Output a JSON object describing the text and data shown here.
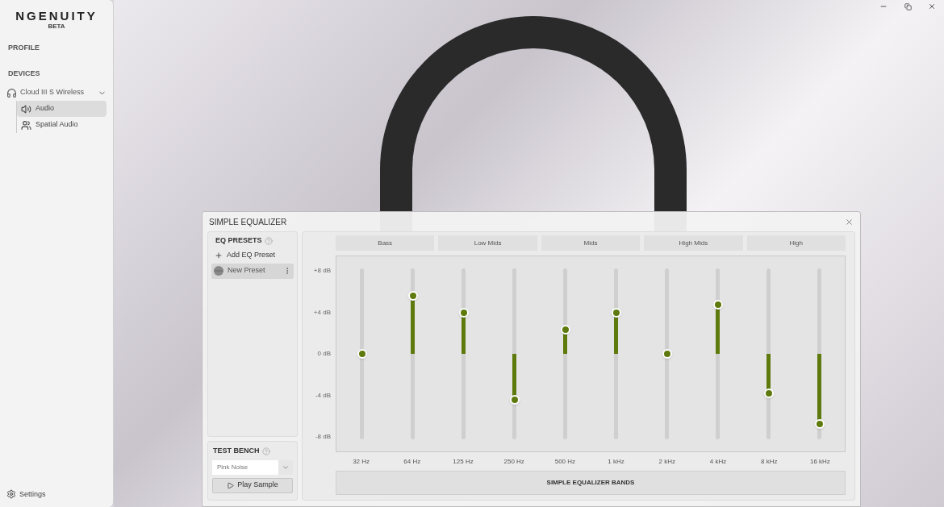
{
  "sidebar": {
    "logo": "NGENUITY",
    "logo_badge": "BETA",
    "sections": [
      {
        "label": "PROFILE"
      },
      {
        "label": "DEVICES"
      }
    ],
    "device": {
      "name": "Cloud III S Wireless",
      "expanded": true,
      "items": [
        {
          "label": "Audio",
          "kind": "speaker",
          "selected": true
        },
        {
          "label": "Spatial Audio",
          "kind": "spatial",
          "selected": false
        }
      ]
    },
    "settings": "Settings"
  },
  "dialog": {
    "title": "SIMPLE EQUALIZER",
    "presets": {
      "title": "EQ PRESETS",
      "add": "Add EQ Preset",
      "items": [
        {
          "label": "New Preset",
          "selected": true
        }
      ]
    },
    "test_bench": {
      "title": "TEST BENCH",
      "source": "Pink Noise",
      "play": "Play Sample"
    },
    "groups": [
      "Bass",
      "Low Mids",
      "Mids",
      "High Mids",
      "High"
    ],
    "db_labels": [
      "+8 dB",
      "+4 dB",
      "0 dB",
      "-4 dB",
      "-8 dB"
    ],
    "bands": [
      {
        "label": "32 Hz",
        "level": 0.5
      },
      {
        "label": "64 Hz",
        "level": 0.84
      },
      {
        "label": "125 Hz",
        "level": 0.74
      },
      {
        "label": "250 Hz",
        "level": 0.23
      },
      {
        "label": "500 Hz",
        "level": 0.64
      },
      {
        "label": "1 kHz",
        "level": 0.74
      },
      {
        "label": "2 kHz",
        "level": 0.5
      },
      {
        "label": "4 kHz",
        "level": 0.79
      },
      {
        "label": "8 kHz",
        "level": 0.27
      },
      {
        "label": "16 kHz",
        "level": 0.09
      }
    ],
    "footer": "SIMPLE EQUALIZER BANDS"
  }
}
